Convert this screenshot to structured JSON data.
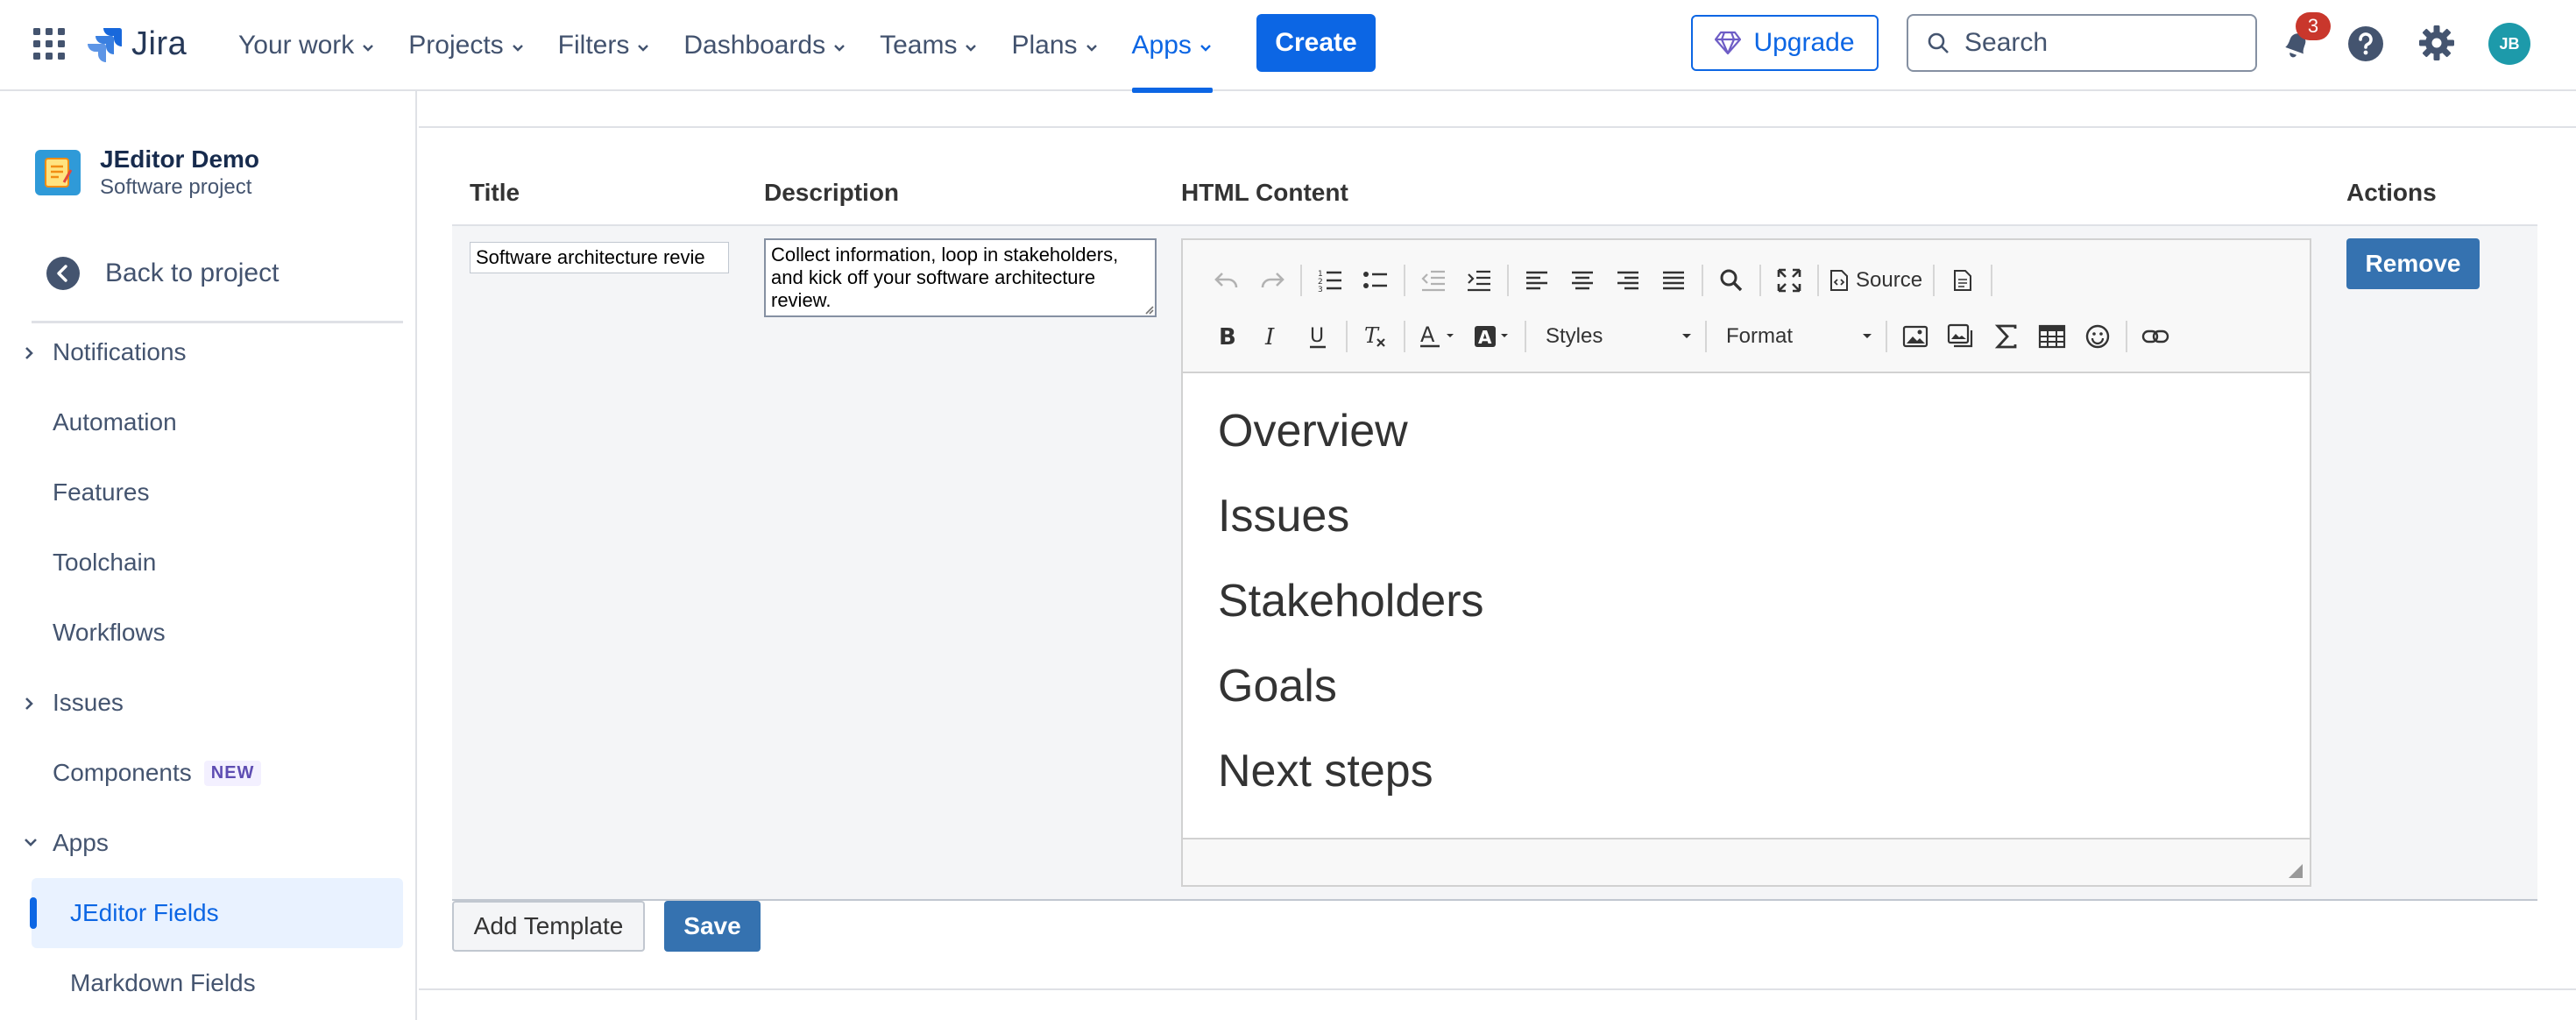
{
  "nav": {
    "brand": "Jira",
    "items": [
      {
        "label": "Your work"
      },
      {
        "label": "Projects"
      },
      {
        "label": "Filters"
      },
      {
        "label": "Dashboards"
      },
      {
        "label": "Teams"
      },
      {
        "label": "Plans"
      },
      {
        "label": "Apps",
        "active": true
      }
    ],
    "create_label": "Create",
    "upgrade_label": "Upgrade",
    "search_placeholder": "Search",
    "notification_count": "3",
    "avatar_initials": "JB",
    "accent_color": "#0c66e4"
  },
  "sidebar": {
    "project_name": "JEditor Demo",
    "project_type": "Software project",
    "back_label": "Back to project",
    "items": [
      {
        "label": "Notifications",
        "expandable": true
      },
      {
        "label": "Automation"
      },
      {
        "label": "Features"
      },
      {
        "label": "Toolchain"
      },
      {
        "label": "Workflows"
      },
      {
        "label": "Issues",
        "expandable": true
      },
      {
        "label": "Components",
        "badge": "NEW"
      },
      {
        "label": "Apps",
        "expanded": true
      },
      {
        "label": "JEditor Fields",
        "selected": true
      },
      {
        "label": "Markdown Fields"
      }
    ]
  },
  "table": {
    "headers": {
      "title": "Title",
      "description": "Description",
      "html_content": "HTML Content",
      "actions": "Actions"
    },
    "row": {
      "title_value": "Software architecture revie",
      "description_value": "Collect information, loop in stakeholders, and kick off your software architecture review.",
      "remove_label": "Remove"
    }
  },
  "editor": {
    "source_label": "Source",
    "styles_label": "Styles",
    "format_label": "Format",
    "headings": [
      "Overview",
      "Issues",
      "Stakeholders",
      "Goals",
      "Next steps"
    ]
  },
  "footer": {
    "add_template_label": "Add Template",
    "save_label": "Save"
  }
}
